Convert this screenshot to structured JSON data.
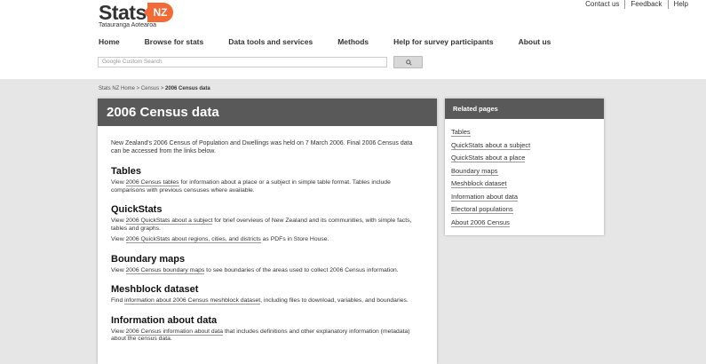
{
  "logo": {
    "word": "Stats",
    "badge": "NZ",
    "tagline": "Tatauranga Aotearoa"
  },
  "utility": [
    "Contact us",
    "Feedback",
    "Help"
  ],
  "nav": [
    "Home",
    "Browse for stats",
    "Data tools and services",
    "Methods",
    "Help for survey participants",
    "About us"
  ],
  "search": {
    "placeholder": "Google Custom Search"
  },
  "breadcrumb": {
    "path": "Stats NZ Home > Census > ",
    "current": "2006 Census data"
  },
  "main": {
    "title": "2006 Census data",
    "intro": "New Zealand's 2006 Census of Population and Dwellings was held on 7 March 2006. Final 2006 Census data can be accessed from the links below.",
    "sections": [
      {
        "heading": "Tables",
        "p1_pre": "View ",
        "p1_link": "2006 Census tables",
        "p1_post": " for information about a place or a subject in simple table format. Tables include comparisons with previous censuses where available."
      },
      {
        "heading": "QuickStats",
        "p1_pre": "View ",
        "p1_link": "2006 QuickStats about a subject",
        "p1_post": " for brief overviews of New Zealand and its communities, with simple facts, tables and graphs.",
        "p2_pre": "View ",
        "p2_link": "2006 QuickStats about regions, cities, and districts",
        "p2_post": " as PDFs in Store House."
      },
      {
        "heading": "Boundary maps",
        "p1_pre": "View ",
        "p1_link": "2006 Census boundary maps",
        "p1_post": " to see boundaries of the areas used to collect 2006 Census information."
      },
      {
        "heading": "Meshblock dataset",
        "p1_pre": "Find ",
        "p1_link": "information about 2006 Census meshblock dataset",
        "p1_post": ", including files to download, variables, and boundaries."
      },
      {
        "heading": "Information about data",
        "p1_pre": "View ",
        "p1_link": "2006 Census information about data",
        "p1_post": " that includes definitions and other explanatory information (metadata) about the census data."
      }
    ]
  },
  "related": {
    "title": "Related pages",
    "items": [
      "Tables",
      "QuickStats about a subject",
      "QuickStats about a place",
      "Boundary maps",
      "Meshblock dataset",
      "Information about data",
      "Electoral populations",
      "About 2006 Census"
    ]
  },
  "colors": {
    "accent": "#f26a36",
    "panel_header": "#595959",
    "page_bg": "#e6e6e6"
  }
}
